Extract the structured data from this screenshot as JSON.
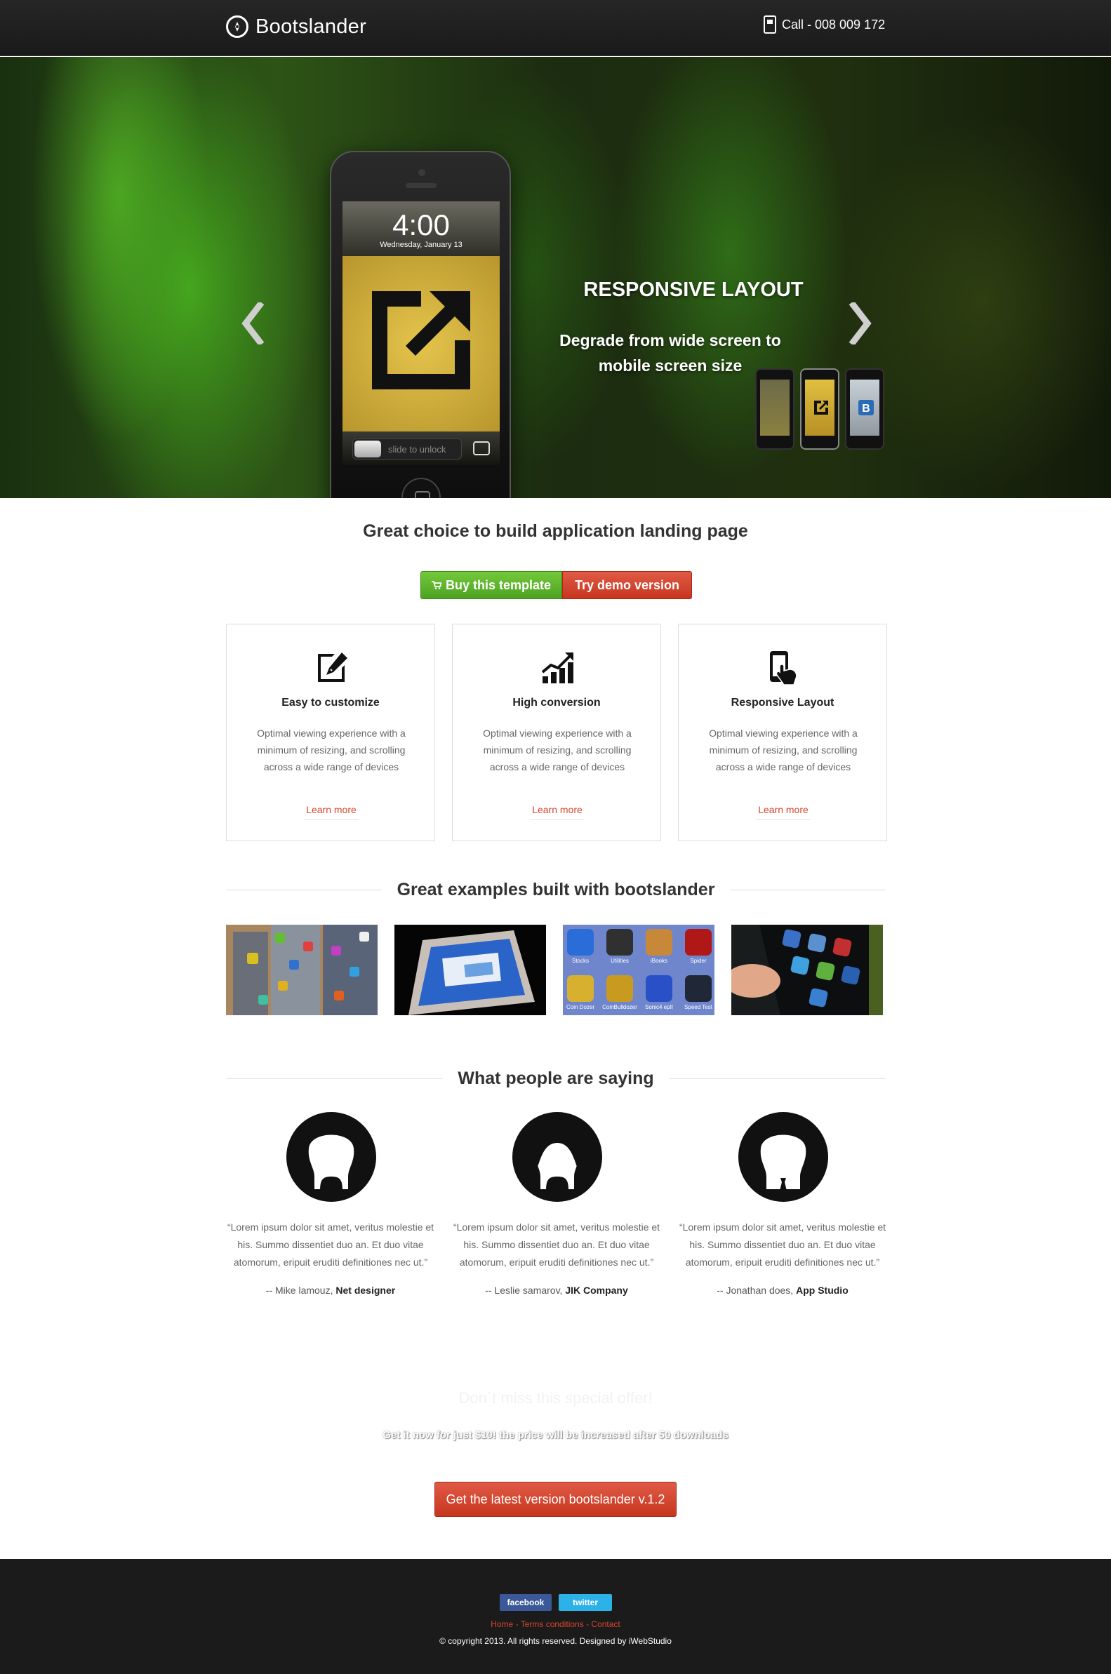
{
  "navbar": {
    "brand": "Bootslander",
    "call": "Call - 008 009 172"
  },
  "hero": {
    "title": "RESPONSIVE LAYOUT",
    "subtitle_line1": "Degrade from wide screen to",
    "subtitle_line2": "mobile screen size",
    "phone_time": "4:00",
    "phone_date": "Wednesday, January 13",
    "phone_slider": "slide to unlock",
    "prev_icon": "chevron-left-icon",
    "next_icon": "chevron-right-icon"
  },
  "intro": {
    "tagline": "Great choice to build application landing page",
    "buy_label": "Buy this template",
    "try_label": "Try demo version"
  },
  "features": [
    {
      "icon": "edit-icon",
      "title": "Easy to customize",
      "text": "Optimal viewing experience with a minimum of resizing, and scrolling across a wide range of devices",
      "link": "Learn more"
    },
    {
      "icon": "growth-chart-icon",
      "title": "High conversion",
      "text": "Optimal viewing experience with a minimum of resizing, and scrolling across a wide range of devices",
      "link": "Learn more"
    },
    {
      "icon": "touch-phone-icon",
      "title": "Responsive Layout",
      "text": "Optimal viewing experience with a minimum of resizing, and scrolling across a wide range of devices",
      "link": "Learn more"
    }
  ],
  "examples": {
    "heading": "Great examples built with bootslander",
    "ex3_labels": [
      "Stocks",
      "Utilities",
      "iBooks",
      "Spider",
      "Coin Dozer",
      "CoinBulldozer",
      "Sonic4 epII",
      "Speed Test"
    ]
  },
  "testimonials": {
    "heading": "What people are saying",
    "items": [
      {
        "quote": "“Lorem ipsum dolor sit amet, veritus molestie et his. Summo dissentiet duo an. Et duo vitae atomorum, eripuit eruditi definitiones nec ut.”",
        "name": "-- Mike lamouz, ",
        "company": "Net designer"
      },
      {
        "quote": "“Lorem ipsum dolor sit amet, veritus molestie et his. Summo dissentiet duo an. Et duo vitae atomorum, eripuit eruditi definitiones nec ut.”",
        "name": "-- Leslie samarov, ",
        "company": "JIK Company"
      },
      {
        "quote": "“Lorem ipsum dolor sit amet, veritus molestie et his. Summo dissentiet duo an. Et duo vitae atomorum, eripuit eruditi definitiones nec ut.”",
        "name": "-- Jonathan does, ",
        "company": "App Studio"
      }
    ]
  },
  "offer": {
    "title": "Don´t miss this special offer!",
    "subtitle": "Get it now for just $10! the price will be increased after 50 downloads",
    "button": "Get the latest version bootslander v.1.2"
  },
  "footer": {
    "facebook": "facebook",
    "twitter": "twitter",
    "link_home": "Home",
    "link_terms": "Terms conditions",
    "link_contact": "Contact",
    "separator": " - ",
    "copyright": "© copyright 2013. All rights reserved. Designed by iWebStudio"
  },
  "colors": {
    "accent_red": "#d9452e",
    "accent_green": "#5bb22c",
    "dark": "#1b1b1b"
  }
}
